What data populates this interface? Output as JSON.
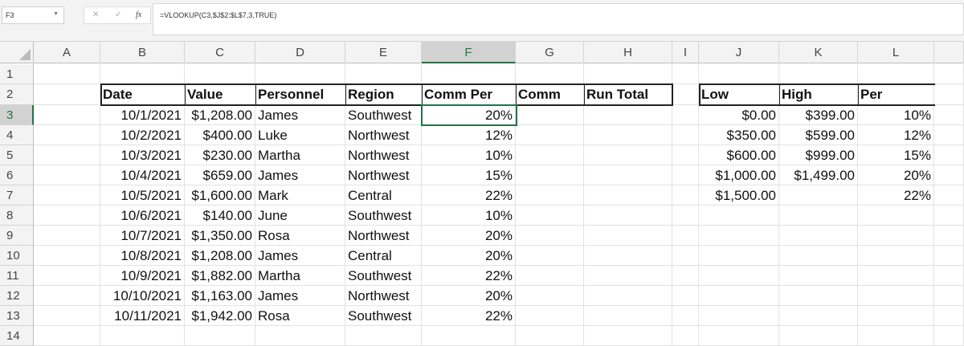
{
  "name_box": "F3",
  "formula": "=VLOOKUP(C3,$J$2:$L$7,3,TRUE)",
  "icons": {
    "cancel": "✕",
    "enter": "✓",
    "fx": "fx"
  },
  "selected_cell": "F3",
  "accent_color": "#217346",
  "columns": [
    "A",
    "B",
    "C",
    "D",
    "E",
    "F",
    "G",
    "H",
    "I",
    "J",
    "K",
    "L"
  ],
  "rows": [
    "1",
    "2",
    "3",
    "4",
    "5",
    "6",
    "7",
    "8",
    "9",
    "10",
    "11",
    "12",
    "13",
    "14"
  ],
  "main_table": {
    "headers": [
      "Date",
      "Value",
      "Personnel",
      "Region",
      "Comm Per",
      "Comm",
      "Run Total"
    ],
    "rows": [
      [
        "10/1/2021",
        "$1,208.00",
        "James",
        "Southwest",
        "20%"
      ],
      [
        "10/2/2021",
        "$400.00",
        "Luke",
        "Northwest",
        "12%"
      ],
      [
        "10/3/2021",
        "$230.00",
        "Martha",
        "Northwest",
        "10%"
      ],
      [
        "10/4/2021",
        "$659.00",
        "James",
        "Northwest",
        "15%"
      ],
      [
        "10/5/2021",
        "$1,600.00",
        "Mark",
        "Central",
        "22%"
      ],
      [
        "10/6/2021",
        "$140.00",
        "June",
        "Southwest",
        "10%"
      ],
      [
        "10/7/2021",
        "$1,350.00",
        "Rosa",
        "Northwest",
        "20%"
      ],
      [
        "10/8/2021",
        "$1,208.00",
        "James",
        "Central",
        "20%"
      ],
      [
        "10/9/2021",
        "$1,882.00",
        "Martha",
        "Southwest",
        "22%"
      ],
      [
        "10/10/2021",
        "$1,163.00",
        "James",
        "Northwest",
        "20%"
      ],
      [
        "10/11/2021",
        "$1,942.00",
        "Rosa",
        "Southwest",
        "22%"
      ]
    ]
  },
  "lookup_table": {
    "headers": [
      "Low",
      "High",
      "Per"
    ],
    "rows": [
      [
        "$0.00",
        "$399.00",
        "10%"
      ],
      [
        "$350.00",
        "$599.00",
        "12%"
      ],
      [
        "$600.00",
        "$999.00",
        "15%"
      ],
      [
        "$1,000.00",
        "$1,499.00",
        "20%"
      ],
      [
        "$1,500.00",
        "",
        "22%"
      ]
    ]
  }
}
